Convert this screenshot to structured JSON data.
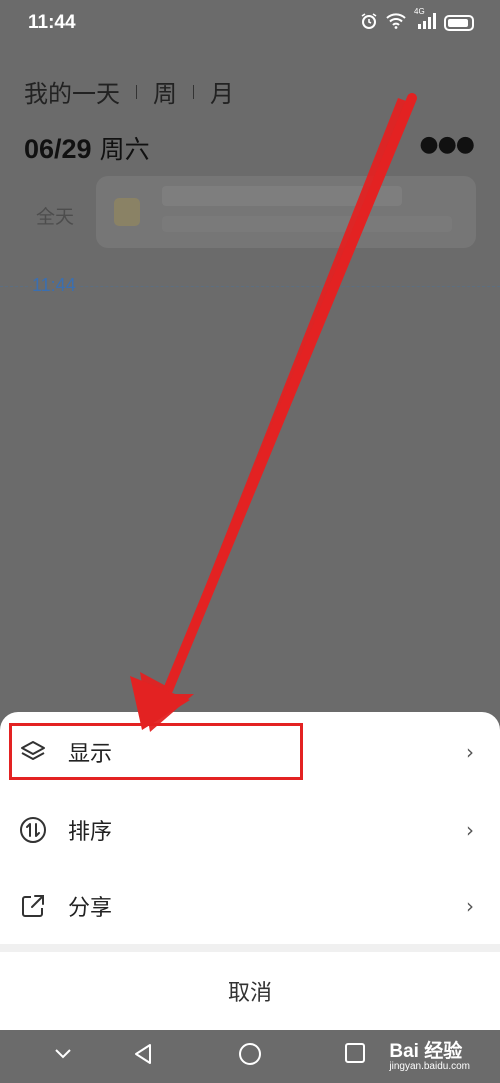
{
  "status_bar": {
    "time": "11:44",
    "network": "4G"
  },
  "calendar": {
    "tabs": [
      "我的一天",
      "周",
      "月"
    ],
    "date": "06/29",
    "weekday": "周六",
    "all_day_label": "全天",
    "now_time": "11:44"
  },
  "sheet": {
    "items": [
      {
        "label": "显示",
        "icon": "layers-icon"
      },
      {
        "label": "排序",
        "icon": "sort-icon"
      },
      {
        "label": "分享",
        "icon": "share-icon"
      }
    ],
    "cancel_label": "取消"
  },
  "watermark": {
    "brand": "Bai 经验",
    "url": "jingyan.baidu.com"
  },
  "colors": {
    "highlight": "#e32222",
    "dim_overlay": "#6b6b6b",
    "link_blue": "#3b6fb0"
  }
}
